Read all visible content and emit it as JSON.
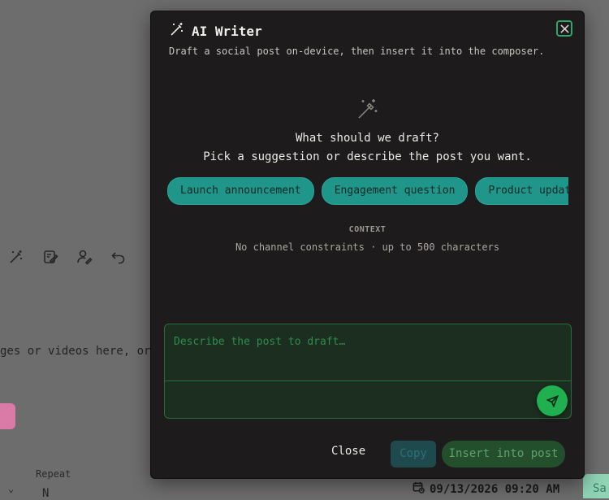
{
  "background": {
    "toolbar_icons": [
      "magic-wand-icon",
      "note-edit-icon",
      "user-edit-icon",
      "undo-icon"
    ],
    "dropzone_text": "ges or videos here, or",
    "repeat_label": "Repeat",
    "repeat_value": "N",
    "schedule_value": "09/13/2026 09:20 AM",
    "save_label": "Sa"
  },
  "modal": {
    "title": "AI Writer",
    "subtitle": "Draft a social post on-device, then insert it into the composer.",
    "empty_state": {
      "question": "What should we draft?",
      "help": "Pick a suggestion or describe the post you want."
    },
    "suggestions": [
      "Launch announcement",
      "Engagement question",
      "Product update"
    ],
    "context": {
      "label": "CONTEXT",
      "value": "No channel constraints · up to 500 characters"
    },
    "prompt": {
      "placeholder": "Describe the post to draft…",
      "value": ""
    },
    "footer": {
      "close_label": "Close",
      "copy_label": "Copy",
      "insert_label": "Insert into post"
    }
  },
  "colors": {
    "modal_bg": "#1d1b1b",
    "chip_teal": "#20958a",
    "send_green": "#20b04f",
    "insert_green": "#244f2c",
    "copy_teal": "#1f4a4d",
    "overlay": "#6e6d6d"
  }
}
